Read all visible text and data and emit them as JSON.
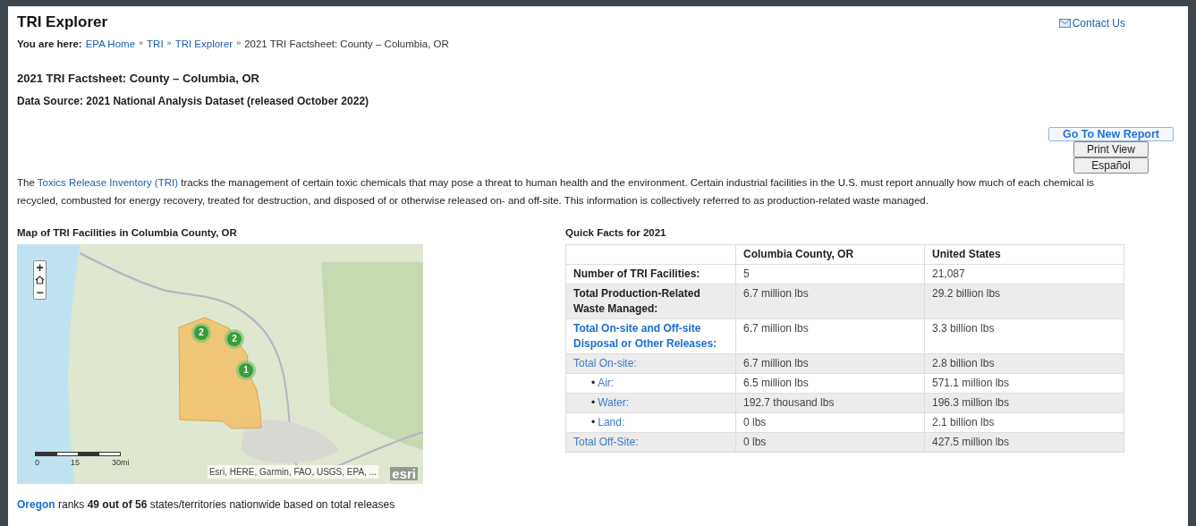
{
  "header": {
    "title": "TRI Explorer",
    "contact": "Contact Us"
  },
  "breadcrumb": {
    "label": "You are here:",
    "separator": "»",
    "items": [
      {
        "label": "EPA Home",
        "link": true
      },
      {
        "label": "TRI",
        "link": true
      },
      {
        "label": "TRI Explorer",
        "link": true
      },
      {
        "label": "2021 TRI Factsheet: County – Columbia, OR",
        "link": false
      }
    ]
  },
  "factsheet_title": "2021 TRI Factsheet: County – Columbia, OR",
  "data_source": "Data Source: 2021 National Analysis Dataset (released October 2022)",
  "buttons": [
    {
      "label": "Go To New Report",
      "kind": "primary"
    },
    {
      "label": "Print View",
      "kind": "plain"
    },
    {
      "label": "Español",
      "kind": "plain"
    }
  ],
  "intro": {
    "before": "The ",
    "link": "Toxics Release Inventory (TRI)",
    "after": " tracks the management of certain toxic chemicals that may pose a threat to human health and the environment. Certain industrial facilities in the U.S. must report annually how much of each chemical is recycled, combusted for energy recovery, treated for destruction, and disposed of or otherwise released on- and off-site. This information is collectively referred to as production-related waste managed."
  },
  "map": {
    "title": "Map of TRI Facilities in Columbia County, OR",
    "zoom_in": "+",
    "zoom_out": "−",
    "clusters": [
      {
        "count": "2"
      },
      {
        "count": "2"
      },
      {
        "count": "1"
      }
    ],
    "scale_labels": [
      "0",
      "15",
      "30mi"
    ],
    "attribution": "Esri, HERE, Garmin, FAO, USGS, EPA, ...",
    "logo": "esri"
  },
  "quick_facts": {
    "title": "Quick Facts for 2021",
    "columns": [
      "",
      "Columbia County, OR",
      "United States"
    ],
    "rows": [
      {
        "kind": "bold",
        "label": "Number of TRI Facilities:",
        "values": [
          "5",
          "21,087"
        ]
      },
      {
        "kind": "bold",
        "label": "Total Production-Related Waste Managed:",
        "values": [
          "6.7 million lbs",
          "29.2 billion lbs"
        ]
      },
      {
        "kind": "bold-link",
        "label": "Total On-site and Off-site Disposal or Other Releases:",
        "values": [
          "6.7 million lbs",
          "3.3 billion lbs"
        ]
      },
      {
        "kind": "link",
        "label": "Total On-site:",
        "values": [
          "6.7 million lbs",
          "2.8 billion lbs"
        ]
      },
      {
        "kind": "bullet-link",
        "bullet": "•",
        "label": "Air:",
        "values": [
          "6.5 million lbs",
          "571.1 million lbs"
        ]
      },
      {
        "kind": "bullet-link",
        "bullet": "•",
        "label": "Water:",
        "values": [
          "192.7 thousand lbs",
          "196.3 million lbs"
        ]
      },
      {
        "kind": "bullet-link",
        "bullet": "•",
        "label": "Land:",
        "values": [
          "0 lbs",
          "2.1 billion lbs"
        ]
      },
      {
        "kind": "link",
        "label": "Total Off-Site:",
        "values": [
          "0 lbs",
          "427.5 million lbs"
        ]
      }
    ]
  },
  "ranking": {
    "link": "Oregon",
    "text": " ranks **49 out of 56** states/territories nationwide based on total releases"
  }
}
